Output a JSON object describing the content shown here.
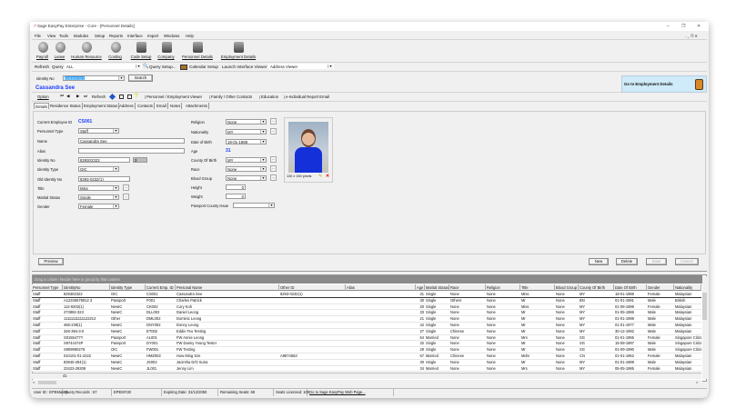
{
  "window": {
    "title": "Sage EasyPay Enterprise - Core - [Personnel Details]",
    "minimize": "–",
    "restore": "❐",
    "close": "✕",
    "inner_controls": "- _ ❐ ✕"
  },
  "menu": [
    "File",
    "View",
    "Tools",
    "Modules",
    "Setup",
    "Reports",
    "Interface",
    "Import",
    "Windows",
    "Help"
  ],
  "toolbar": [
    {
      "label": "Payroll",
      "icon": "payroll-icon"
    },
    {
      "label": "Leave",
      "icon": "leave-icon"
    },
    {
      "label": "Human Resource",
      "icon": "human-resource-icon"
    },
    {
      "label": "Costing",
      "icon": "costing-icon"
    },
    {
      "label": "Code Setup",
      "icon": "code-setup-icon"
    },
    {
      "label": "Company",
      "icon": "company-icon"
    },
    {
      "label": "Personnel Details",
      "icon": "personnel-details-icon"
    },
    {
      "label": "Employment Details",
      "icon": "employment-details-icon"
    }
  ],
  "querybar": {
    "refresh": "Refresh",
    "query_label": "Query",
    "query_value": "ALL",
    "query_setup": "Query Setup...",
    "calendar_setup": "Calendar Setup",
    "launch_label": "Launch Interface Viewer",
    "viewer_value": "Address Viewer"
  },
  "identity": {
    "label": "Identity No",
    "value": "829302323",
    "search": "Search",
    "name": "Cassandra See",
    "goto": "Go to  Employment Details"
  },
  "navbar": {
    "option": "Option",
    "refresh": "Refresh",
    "links": [
      "Personnel / Employment Viewer",
      "Family / Other Contacts",
      "Education",
      "e-Individual Report Email"
    ]
  },
  "tabs": [
    "Details",
    "Residence Status",
    "Employment Status",
    "Address",
    "Contacts",
    "Email",
    "Notes",
    "Attachments"
  ],
  "form": {
    "left": [
      {
        "label": "Current Employee ID",
        "value": "CS001"
      },
      {
        "label": "Personnel Type",
        "value": "Staff"
      },
      {
        "label": "Name",
        "value": "Cassandra See"
      },
      {
        "label": "Alias",
        "value": ""
      },
      {
        "label": "Identity No",
        "value": "829302323",
        "extra": "3"
      },
      {
        "label": "Identity Type",
        "value": "OIC"
      },
      {
        "label": "Old Identity No",
        "value": "8293-0232(1)"
      },
      {
        "label": "Title",
        "value": "Miss"
      },
      {
        "label": "Marital Status",
        "value": "Single"
      },
      {
        "label": "Gender",
        "value": "Female"
      }
    ],
    "right": [
      {
        "label": "Religion",
        "value": "None"
      },
      {
        "label": "Nationality",
        "value": "MY"
      },
      {
        "label": "Date of Birth",
        "value": "19-01-1988"
      },
      {
        "label": "Age",
        "value": "31"
      },
      {
        "label": "County Of Birth",
        "value": "MY"
      },
      {
        "label": "Race",
        "value": "None"
      },
      {
        "label": "Blood Group",
        "value": "None"
      },
      {
        "label": "Height",
        "value": "0"
      },
      {
        "label": "Weight",
        "value": "0"
      },
      {
        "label": "Passport County Issue",
        "value": ""
      }
    ],
    "photo_caption": "130 x 150 pixels",
    "ellipsis": "..."
  },
  "buttons": {
    "preview": "Preview",
    "new": "New",
    "delete": "Delete",
    "save": "Save",
    "cancel": "Cancel"
  },
  "grid": {
    "group_hint": "Drag a column header here to group by that column",
    "columns": [
      "Personnel Type",
      "IdentityNo",
      "Identity Type",
      "Current Emp. ID",
      "Personal Name",
      "Other ID",
      "Alias",
      "Age",
      "Marital Status",
      "Race",
      "Religion",
      "Title",
      "Blood Group",
      "County Of Birth",
      "Date Of Birth",
      "Gender",
      "Nationality"
    ],
    "rows": [
      [
        "Staff",
        "829302323",
        "OIC",
        "CS001",
        "Cassandra See",
        "8293-0232(1)",
        "",
        "31",
        "Single",
        "None",
        "None",
        "Miss",
        "None",
        "MY",
        "19-01-1988",
        "Female",
        "Malaysian"
      ],
      [
        "Staff",
        "A12345678912 3",
        "Passport",
        "F001",
        "Charles Patrick",
        "",
        "",
        "30",
        "Single",
        "Others",
        "None",
        "Mr",
        "None",
        "BN",
        "01-01-1991",
        "Male",
        "British"
      ],
      [
        "Staff",
        "112-9302(1)",
        "NewIC",
        "CK002",
        "Cory Koh",
        "",
        "",
        "20",
        "Single",
        "None",
        "None",
        "Miss",
        "None",
        "MY",
        "01-08-1999",
        "Female",
        "Malaysian"
      ],
      [
        "Staff",
        "273892-323",
        "NewIC",
        "DLL002",
        "Daniel Leong",
        "",
        "",
        "33",
        "Single",
        "None",
        "None",
        "Mr",
        "None",
        "MY",
        "01-05-1986",
        "Male",
        "Malaysian"
      ],
      [
        "Staff",
        "11111111111122212",
        "Other",
        "DML002",
        "Dominic Leong",
        "",
        "",
        "21",
        "Single",
        "None",
        "None",
        "Mr",
        "None",
        "MY",
        "01-01-1998",
        "Male",
        "Malaysian"
      ],
      [
        "Staff",
        "468-239(1)",
        "NewIC",
        "DNY002",
        "Donny Leong",
        "",
        "",
        "42",
        "Single",
        "None",
        "None",
        "Mr",
        "None",
        "MY",
        "01-01-1977",
        "Male",
        "Malaysian"
      ],
      [
        "Staff",
        "348-394-3-0",
        "NewIC",
        "ET002",
        "Eddie Teo Testing",
        "",
        "",
        "27",
        "Single",
        "Chinese",
        "None",
        "Mr",
        "None",
        "MY",
        "30-12-1992",
        "Male",
        "Malaysian"
      ],
      [
        "Staff",
        "S0155477Y",
        "Passport",
        "AL001",
        "FW Annie Leong",
        "",
        "",
        "64",
        "Married",
        "None",
        "None",
        "Mrs",
        "None",
        "SG",
        "01-01-1955",
        "Female",
        "Singapore Citizen"
      ],
      [
        "Staff",
        "S9744474P",
        "Passport",
        "DY001",
        "FW Danny Young Tester",
        "",
        "",
        "32",
        "Single",
        "None",
        "None",
        "Mr",
        "None",
        "SG",
        "15-08-1987",
        "Male",
        "Singapore Citizen"
      ],
      [
        "Staff",
        "S909990278",
        "OIC",
        "FW001",
        "FW Testing",
        "",
        "",
        "29",
        "Single",
        "None",
        "None",
        "Mr",
        "None",
        "SG",
        "01-09-1990",
        "Male",
        "Singapore Citizen"
      ],
      [
        "Staff",
        "010101-01-2222",
        "NewIC",
        "HMZ003",
        "How Ming Sze",
        "A9874563",
        "",
        "67",
        "Married",
        "Chinese",
        "None",
        "Mdm",
        "None",
        "CN",
        "01-01-1952",
        "Female",
        "Malaysian"
      ],
      [
        "Staff",
        "83940-294(1)",
        "NewIC",
        "JS002",
        "Jacintha D/O Suria",
        "",
        "",
        "30",
        "Single",
        "None",
        "None",
        "Mr",
        "None",
        "MY",
        "01-01-1989",
        "Male",
        "Malaysian"
      ],
      [
        "Staff",
        "23423-29308",
        "NewIC",
        "JL001",
        "Jenny Lim",
        "",
        "",
        "34",
        "Married",
        "None",
        "None",
        "Mrs",
        "None",
        "MY",
        "05-05-1985",
        "Female",
        "Malaysian"
      ]
    ],
    "footer_count": "41"
  },
  "status": [
    "User ID : EPEMaster",
    "Query Records : 67",
    "EPEMY30",
    "Expiring Date: 31/12/2050",
    "Remaining Seats: 68",
    "Seats Licensed: 100",
    "Go to Sage EasyPay Web Page..."
  ],
  "colors": {
    "accent_blue": "#1a3cff",
    "goto_bg": "#cfeaf8",
    "grid_group_bar": "#8a8a8a"
  }
}
